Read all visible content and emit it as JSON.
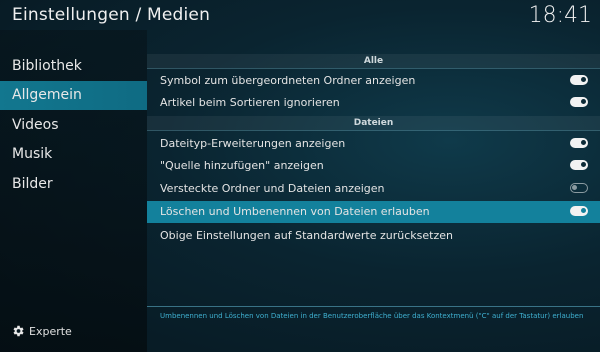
{
  "header": {
    "title": "Einstellungen / Medien",
    "clock": "18:41"
  },
  "sidebar": {
    "items": [
      {
        "label": "Bibliothek",
        "active": false
      },
      {
        "label": "Allgemein",
        "active": true
      },
      {
        "label": "Videos",
        "active": false
      },
      {
        "label": "Musik",
        "active": false
      },
      {
        "label": "Bilder",
        "active": false
      }
    ],
    "expert_label": "Experte",
    "expert_icon": "gear-icon"
  },
  "sections": {
    "alle": "Alle",
    "dateien": "Dateien"
  },
  "settings": [
    {
      "label": "Symbol zum übergeordneten Ordner anzeigen",
      "toggle": "on"
    },
    {
      "label": "Artikel beim Sortieren ignorieren",
      "toggle": "on"
    },
    {
      "label": "Dateityp-Erweiterungen anzeigen",
      "toggle": "on"
    },
    {
      "label": "\"Quelle hinzufügen\" anzeigen",
      "toggle": "on"
    },
    {
      "label": "Versteckte Ordner und Dateien anzeigen",
      "toggle": "off"
    },
    {
      "label": "Löschen und Umbenennen von Dateien erlauben",
      "toggle": "on",
      "focused": true
    },
    {
      "label": "Obige Einstellungen auf Standardwerte zurücksetzen"
    }
  ],
  "footer": {
    "description": "Umbenennen und Löschen von Dateien in der Benutzeroberfläche über das Kontextmenü (\"C\" auf der Tastatur) erlauben"
  },
  "colors": {
    "accent": "#13819c",
    "sidebar_active": "#12778f",
    "footer_text": "#3fb0d0"
  }
}
